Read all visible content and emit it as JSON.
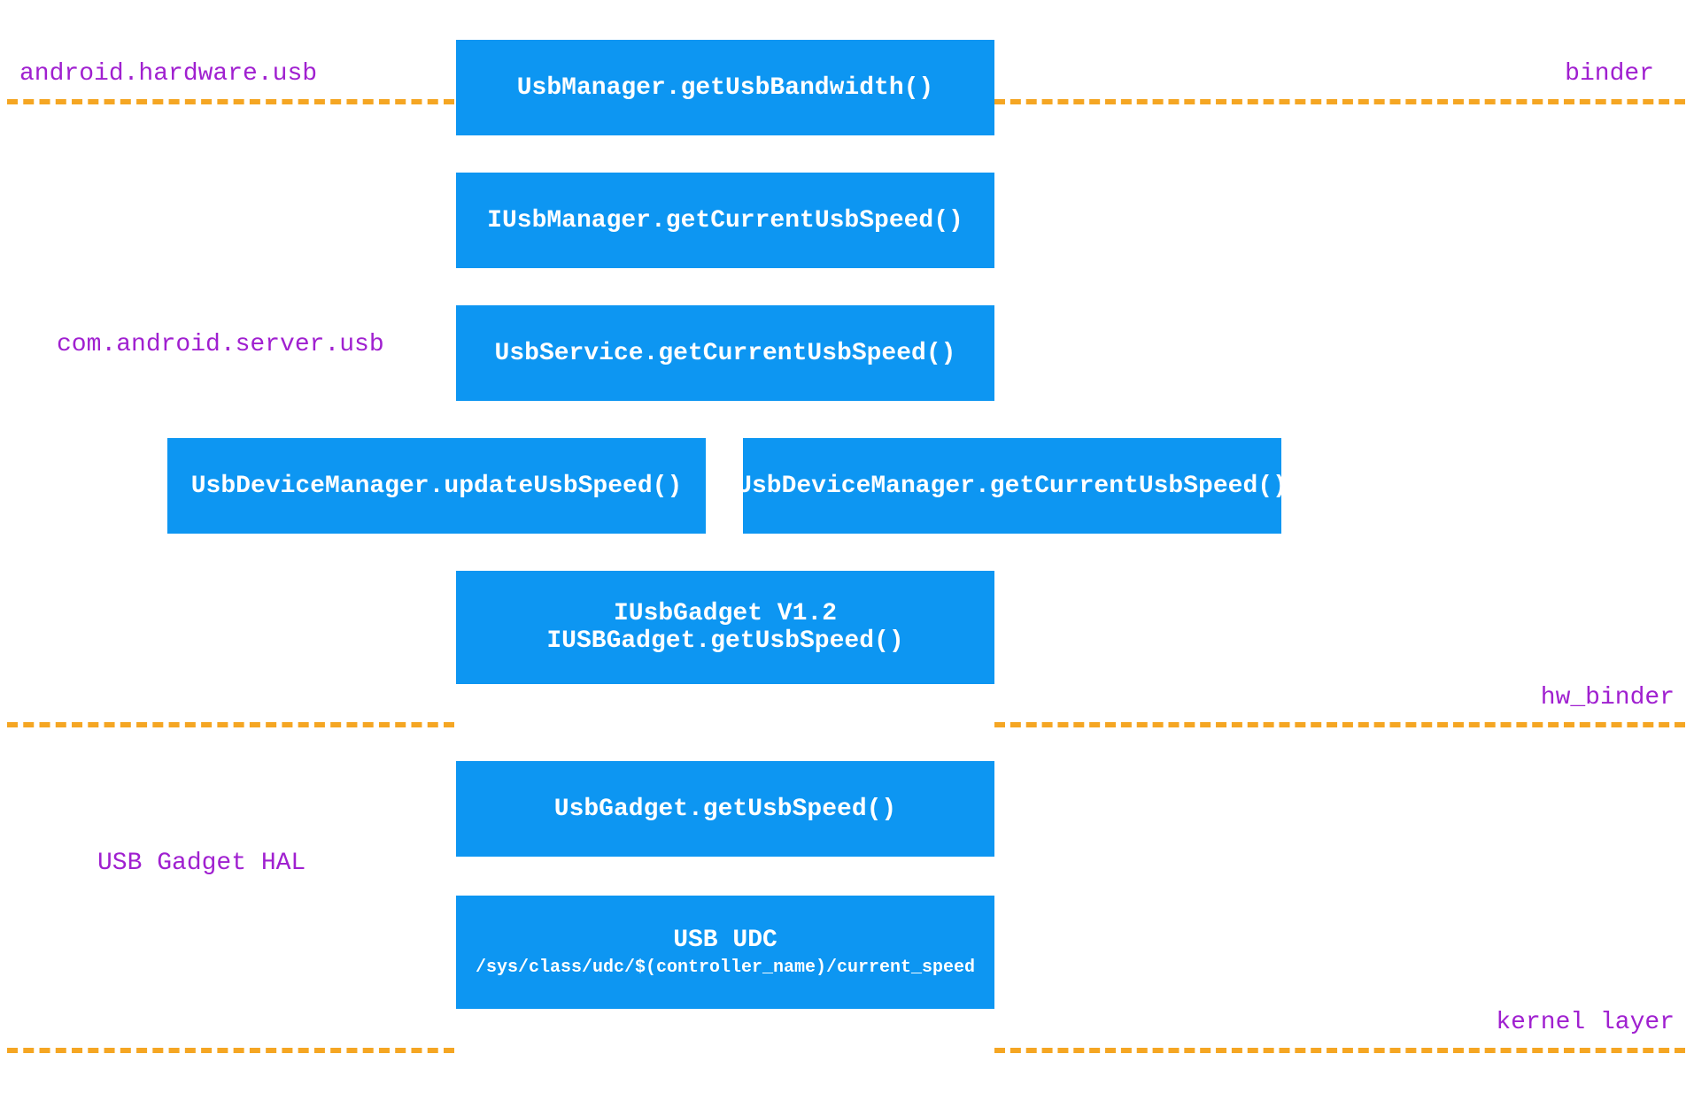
{
  "labels": {
    "android_hardware_usb": "android.hardware.usb",
    "binder": "binder",
    "com_android_server_usb": "com.android.server.usb",
    "hw_binder": "hw_binder",
    "usb_gadget_hal": "USB Gadget HAL",
    "kernel_layer": "kernel layer"
  },
  "boxes": {
    "usbmanager": "UsbManager.getUsbBandwidth()",
    "iusbmanager": "IUsbManager.getCurrentUsbSpeed()",
    "usbservice": "UsbService.getCurrentUsbSpeed()",
    "usbdevicemanager_update": "UsbDeviceManager.updateUsbSpeed()",
    "usbdevicemanager_get": "UsbDeviceManager.getCurrentUsbSpeed()",
    "iusbgadget_title": "IUsbGadget V1.2",
    "iusbgadget_method": "IUSBGadget.getUsbSpeed()",
    "usbgadget": "UsbGadget.getUsbSpeed()",
    "usbudc_title": "USB UDC",
    "usbudc_path": "/sys/class/udc/$(controller_name)/current_speed"
  }
}
